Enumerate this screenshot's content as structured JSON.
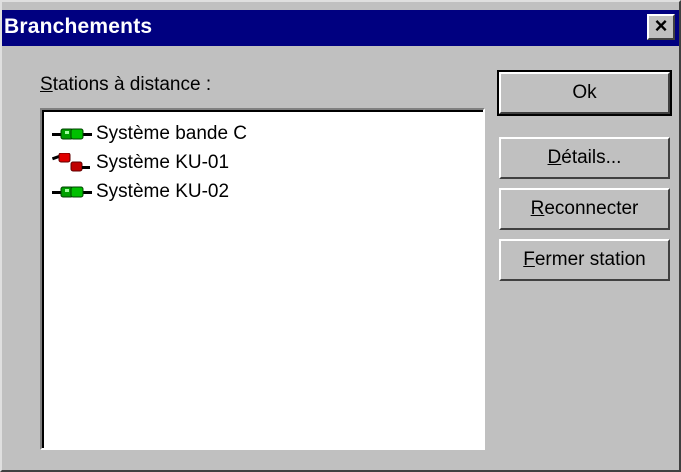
{
  "window": {
    "title": "Branchements"
  },
  "list": {
    "label_mnemonic": "S",
    "label_rest": "tations à distance :",
    "items": [
      {
        "label": "Système bande C",
        "icon": "connected-plug-icon",
        "status_color": "#00a000"
      },
      {
        "label": "Système KU-01",
        "icon": "disconnected-plug-icon",
        "status_color": "#e00000"
      },
      {
        "label": "Système KU-02",
        "icon": "connected-plug-icon",
        "status_color": "#00a000"
      }
    ]
  },
  "buttons": {
    "ok": {
      "label": "Ok"
    },
    "details": {
      "mnemonic": "D",
      "rest": "étails..."
    },
    "reconnect": {
      "mnemonic": "R",
      "rest": "econnecter"
    },
    "close_station": {
      "mnemonic": "F",
      "rest": "ermer station"
    }
  },
  "colors": {
    "titlebar": "#000080",
    "face": "#c0c0c0"
  }
}
